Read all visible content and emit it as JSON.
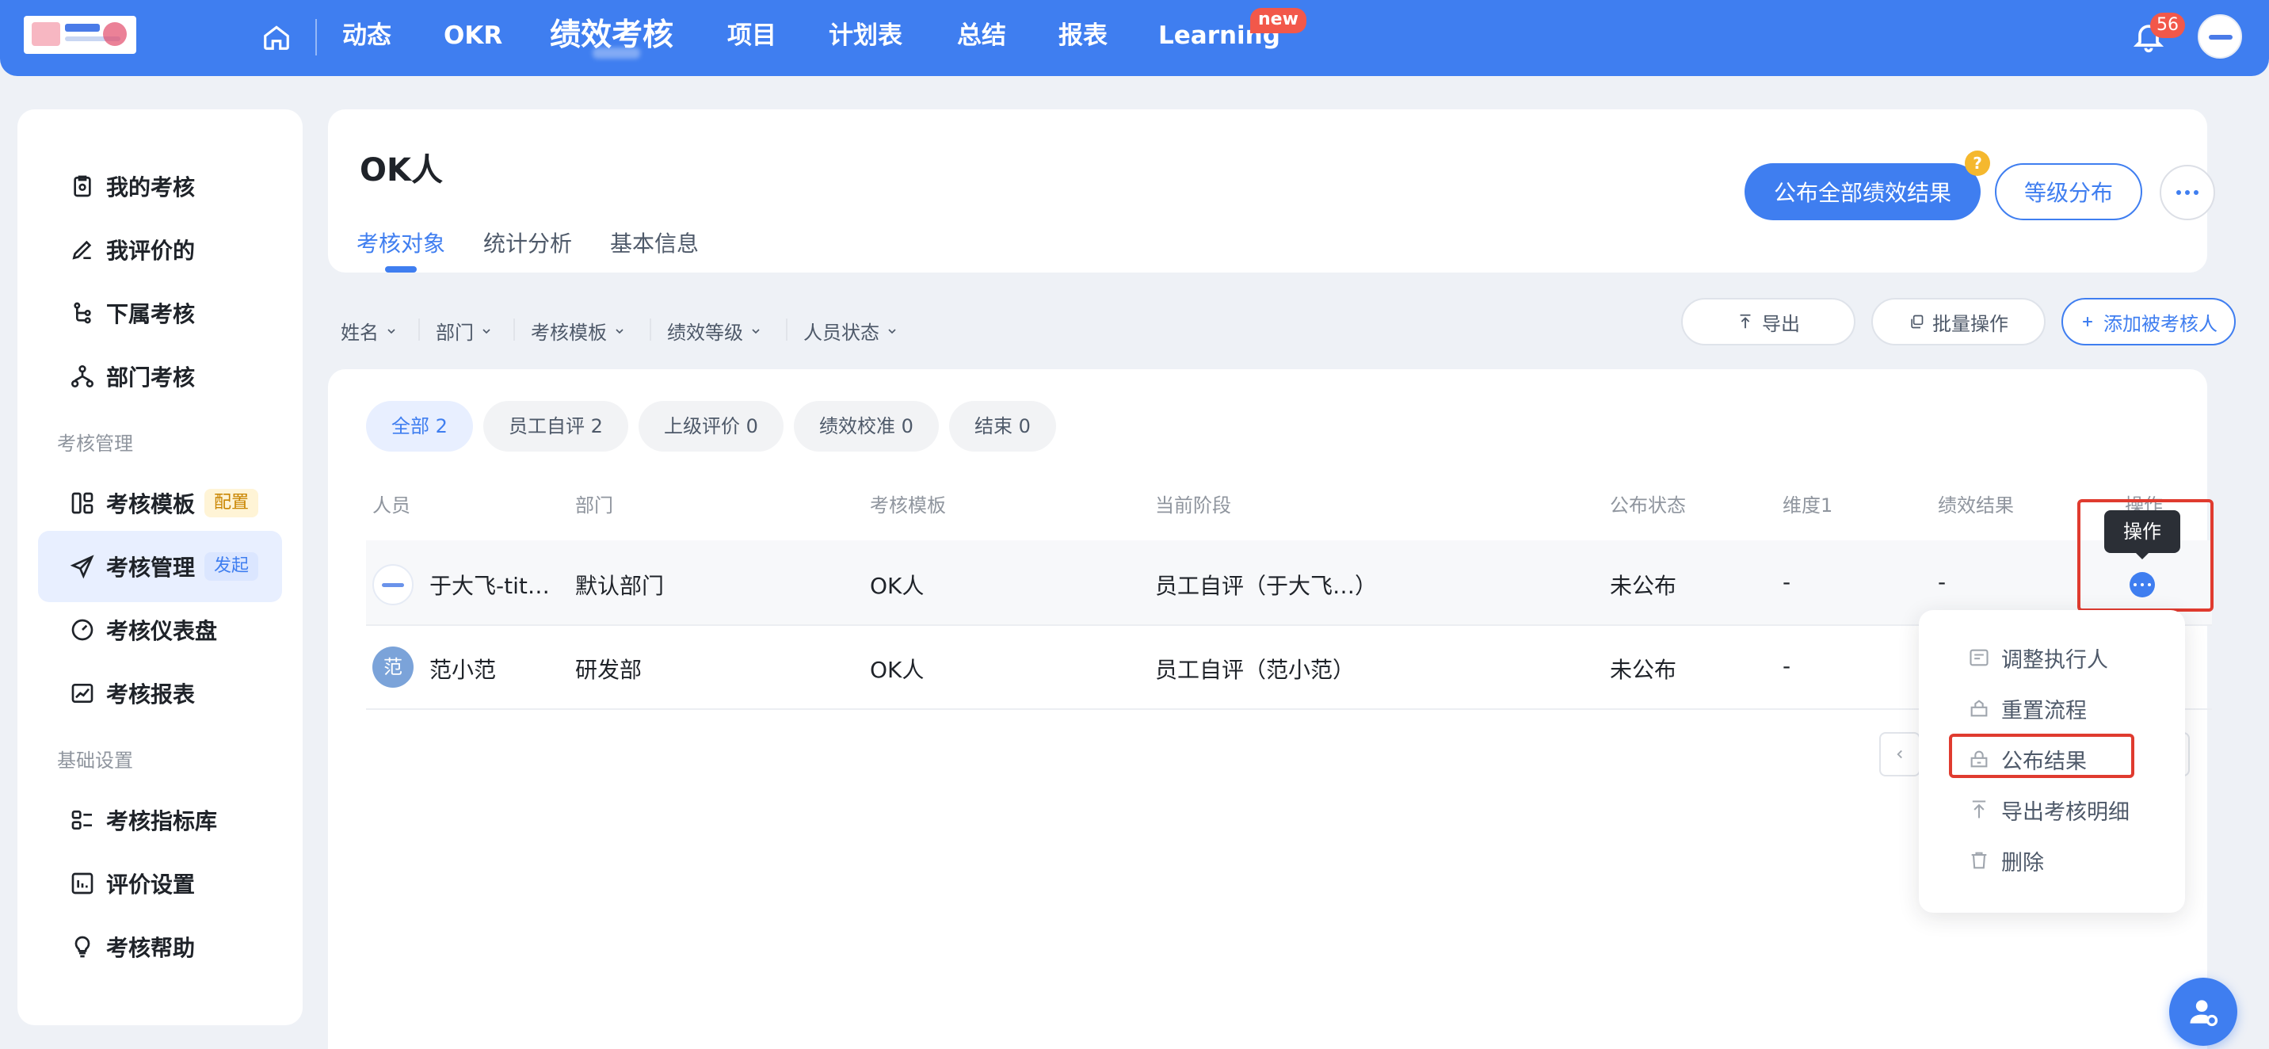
{
  "topnav": {
    "items": [
      "动态",
      "OKR",
      "绩效考核",
      "项目",
      "计划表",
      "总结",
      "报表",
      "Learning"
    ],
    "new_badge": "new",
    "notification_count": "56"
  },
  "sidebar": {
    "items": [
      "我的考核",
      "我评价的",
      "下属考核",
      "部门考核"
    ],
    "section_manage": "考核管理",
    "manage_items": [
      {
        "label": "考核模板",
        "badge": "配置"
      },
      {
        "label": "考核管理",
        "badge": "发起"
      },
      {
        "label": "考核仪表盘"
      },
      {
        "label": "考核报表"
      }
    ],
    "section_basic": "基础设置",
    "basic_items": [
      "考核指标库",
      "评价设置",
      "考核帮助"
    ]
  },
  "header": {
    "title": "OK人",
    "tabs": [
      "考核对象",
      "统计分析",
      "基本信息"
    ],
    "publish_all_label": "公布全部绩效结果",
    "help_mark": "?",
    "grade_label": "等级分布"
  },
  "filters": [
    "姓名",
    "部门",
    "考核模板",
    "绩效等级",
    "人员状态"
  ],
  "toolbar": {
    "export_label": "导出",
    "batch_label": "批量操作",
    "add_label": "添加被考核人"
  },
  "status_chips": [
    "全部 2",
    "员工自评 2",
    "上级评价 0",
    "绩效校准 0",
    "结束 0"
  ],
  "table": {
    "columns": [
      "人员",
      "部门",
      "考核模板",
      "当前阶段",
      "公布状态",
      "维度1",
      "绩效结果",
      "操作"
    ],
    "rows": [
      {
        "name": "于大飞-tit…",
        "dept": "默认部门",
        "template": "OK人",
        "stage": "员工自评（于大飞…）",
        "publish": "未公布",
        "dim1": "-",
        "result": "-"
      },
      {
        "name": "范小范",
        "avatar_text": "范",
        "dept": "研发部",
        "template": "OK人",
        "stage": "员工自评（范小范）",
        "publish": "未公布",
        "dim1": "-"
      }
    ]
  },
  "tooltip": "操作",
  "action_menu": [
    "调整执行人",
    "重置流程",
    "公布结果",
    "导出考核明细",
    "删除"
  ],
  "colors": {
    "primary": "#3f7ef0",
    "highlight": "#e03b2f"
  }
}
